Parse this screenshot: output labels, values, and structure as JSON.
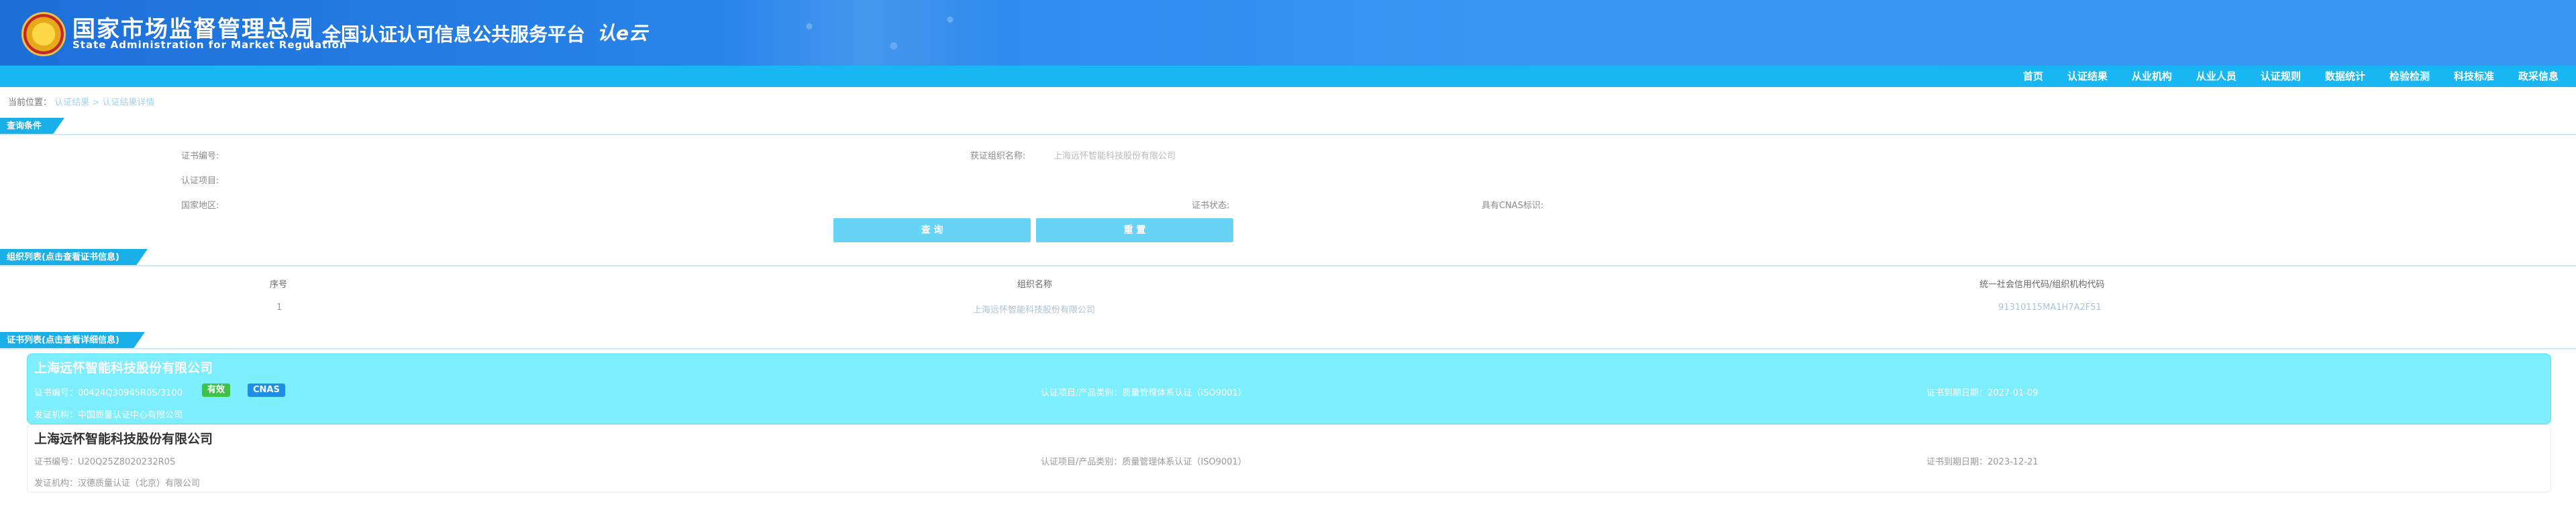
{
  "header": {
    "org_cn": "国家市场监督管理总局",
    "org_en": "State Administration for Market Regulation",
    "platform": "全国认证认可信息公共服务平台",
    "brand_mark": "认e云"
  },
  "nav": [
    "首页",
    "认证结果",
    "从业机构",
    "从业人员",
    "认证规则",
    "数据统计",
    "检验检测",
    "科技标准",
    "政采信息"
  ],
  "breadcrumb": {
    "prefix": "当前位置：",
    "link1": "认证结果",
    "sep": ">",
    "current": "认证结果详情"
  },
  "query": {
    "section": "查询条件",
    "cert_no_label": "证书编号:",
    "org_name_label": "获证组织名称:",
    "org_name_value": "上海远怀智能科技股份有限公司",
    "cert_project_label": "认证项目:",
    "country_label": "国家地区:",
    "cert_status_label": "证书状态:",
    "cnas_label": "具有CNAS标识:",
    "search_btn": "查 询",
    "reset_btn": "重 置"
  },
  "org_list": {
    "section": "组织列表(点击查看证书信息)",
    "headers": [
      "序号",
      "组织名称",
      "统一社会信用代码/组织机构代码"
    ],
    "rows": [
      {
        "seq": "1",
        "name": "上海远怀智能科技股份有限公司",
        "code": "91310115MA1H7A2F51"
      }
    ]
  },
  "cert_list": {
    "section": "证书列表(点击查看详细信息)",
    "items": [
      {
        "company": "上海远怀智能科技股份有限公司",
        "cert_no": "证书编号：00424Q30945R0S/3100",
        "status": "有效",
        "cnas": "CNAS",
        "project": "认证项目/产品类别：质量管理体系认证（ISO9001）",
        "expiry": "证书到期日期：2027-01-09",
        "agency": "发证机构：中国质量认证中心有限公司"
      },
      {
        "company": "上海远怀智能科技股份有限公司",
        "cert_no": "证书编号：U20Q25Z8020232R0S",
        "project": "认证项目/产品类别：质量管理体系认证（ISO9001）",
        "expiry": "证书到期日期：2023-12-21",
        "agency": "发证机构：汉德质量认证（北京）有限公司"
      }
    ]
  },
  "colors": {
    "header_blue": "#2a86ea",
    "nav_blue": "#18b7f4",
    "tag_blue": "#19b0ea",
    "highlight_card": "#7ceefd",
    "status_green": "#3fc24a",
    "cnas_blue": "#1d8ee6"
  }
}
